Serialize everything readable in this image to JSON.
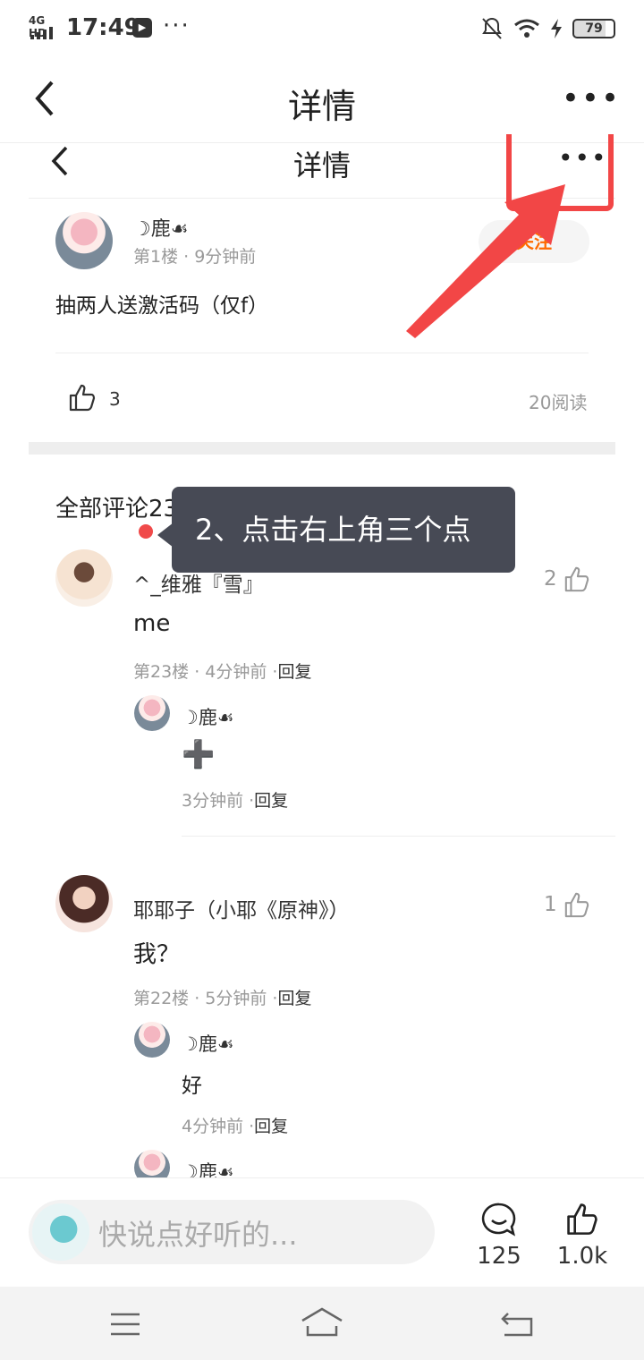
{
  "status_bar": {
    "network": "4G HD",
    "time": "17:49",
    "more": "···",
    "battery": "79"
  },
  "nav": {
    "title": "详情"
  },
  "inner_nav": {
    "title": "详情"
  },
  "post": {
    "author": "☽鹿☙",
    "meta": "第1楼 · 9分钟前",
    "follow_label": "关注",
    "content": "抽两人送激活码（仅f）",
    "likes": "3",
    "reads": "20阅读"
  },
  "comments_header": "全部评论23",
  "tooltip": "2、点击右上角三个点",
  "comments": [
    {
      "author": "^_维雅『雪』",
      "content": "me",
      "meta": "第23楼 · 4分钟前 ·",
      "reply_label": "回复",
      "likes": "2",
      "replies": [
        {
          "author": "☽鹿☙",
          "content": "➕",
          "meta": "3分钟前 ·",
          "reply_label": "回复"
        }
      ]
    },
    {
      "author": "耶耶子（小耶《原神》）",
      "content": "我？",
      "meta": "第22楼 · 5分钟前 ·",
      "reply_label": "回复",
      "likes": "1",
      "replies": [
        {
          "author": "☽鹿☙",
          "content": "好",
          "meta": "4分钟前 ·",
          "reply_label": "回复"
        },
        {
          "author": "☽鹿☙"
        }
      ]
    }
  ],
  "bottom_bar": {
    "input_placeholder": "快说点好听的...",
    "comment_count": "125",
    "like_count": "1.0k"
  }
}
